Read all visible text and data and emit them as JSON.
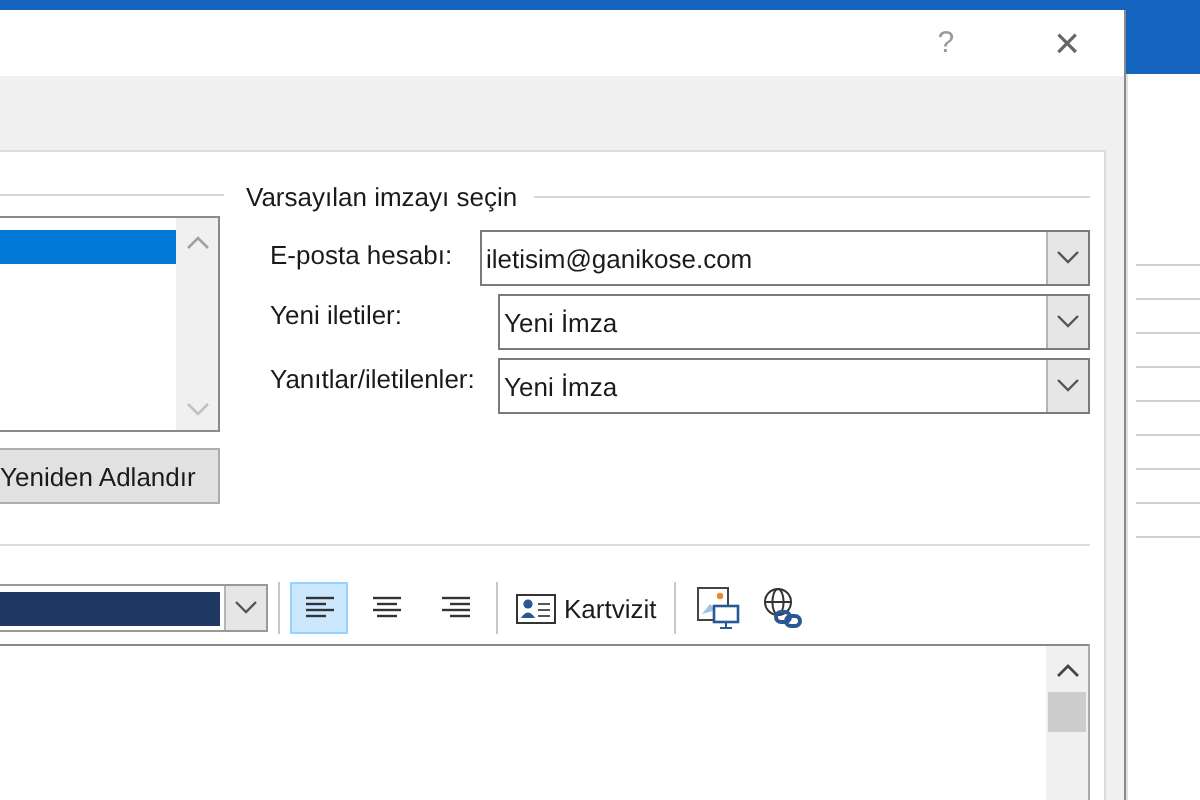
{
  "dialog": {
    "help_button": "?",
    "close_button": "×"
  },
  "signature_list": {
    "items": [
      {
        "selected": true
      }
    ]
  },
  "rename_button": "Yeniden Adlandır",
  "default_signature": {
    "title": "Varsayılan imzayı seçin",
    "fields": [
      {
        "label": "E-posta hesabı:",
        "value": "iletisim@ganikose.com"
      },
      {
        "label": "Yeni iletiler:",
        "value": "Yeni İmza"
      },
      {
        "label": "Yanıtlar/iletilenler:",
        "value": "Yeni İmza"
      }
    ]
  },
  "toolbar": {
    "alignment": [
      {
        "kind": "left",
        "selected": true
      },
      {
        "kind": "center",
        "selected": false
      },
      {
        "kind": "right",
        "selected": false
      }
    ],
    "business_card_button": "Kartvizit"
  }
}
